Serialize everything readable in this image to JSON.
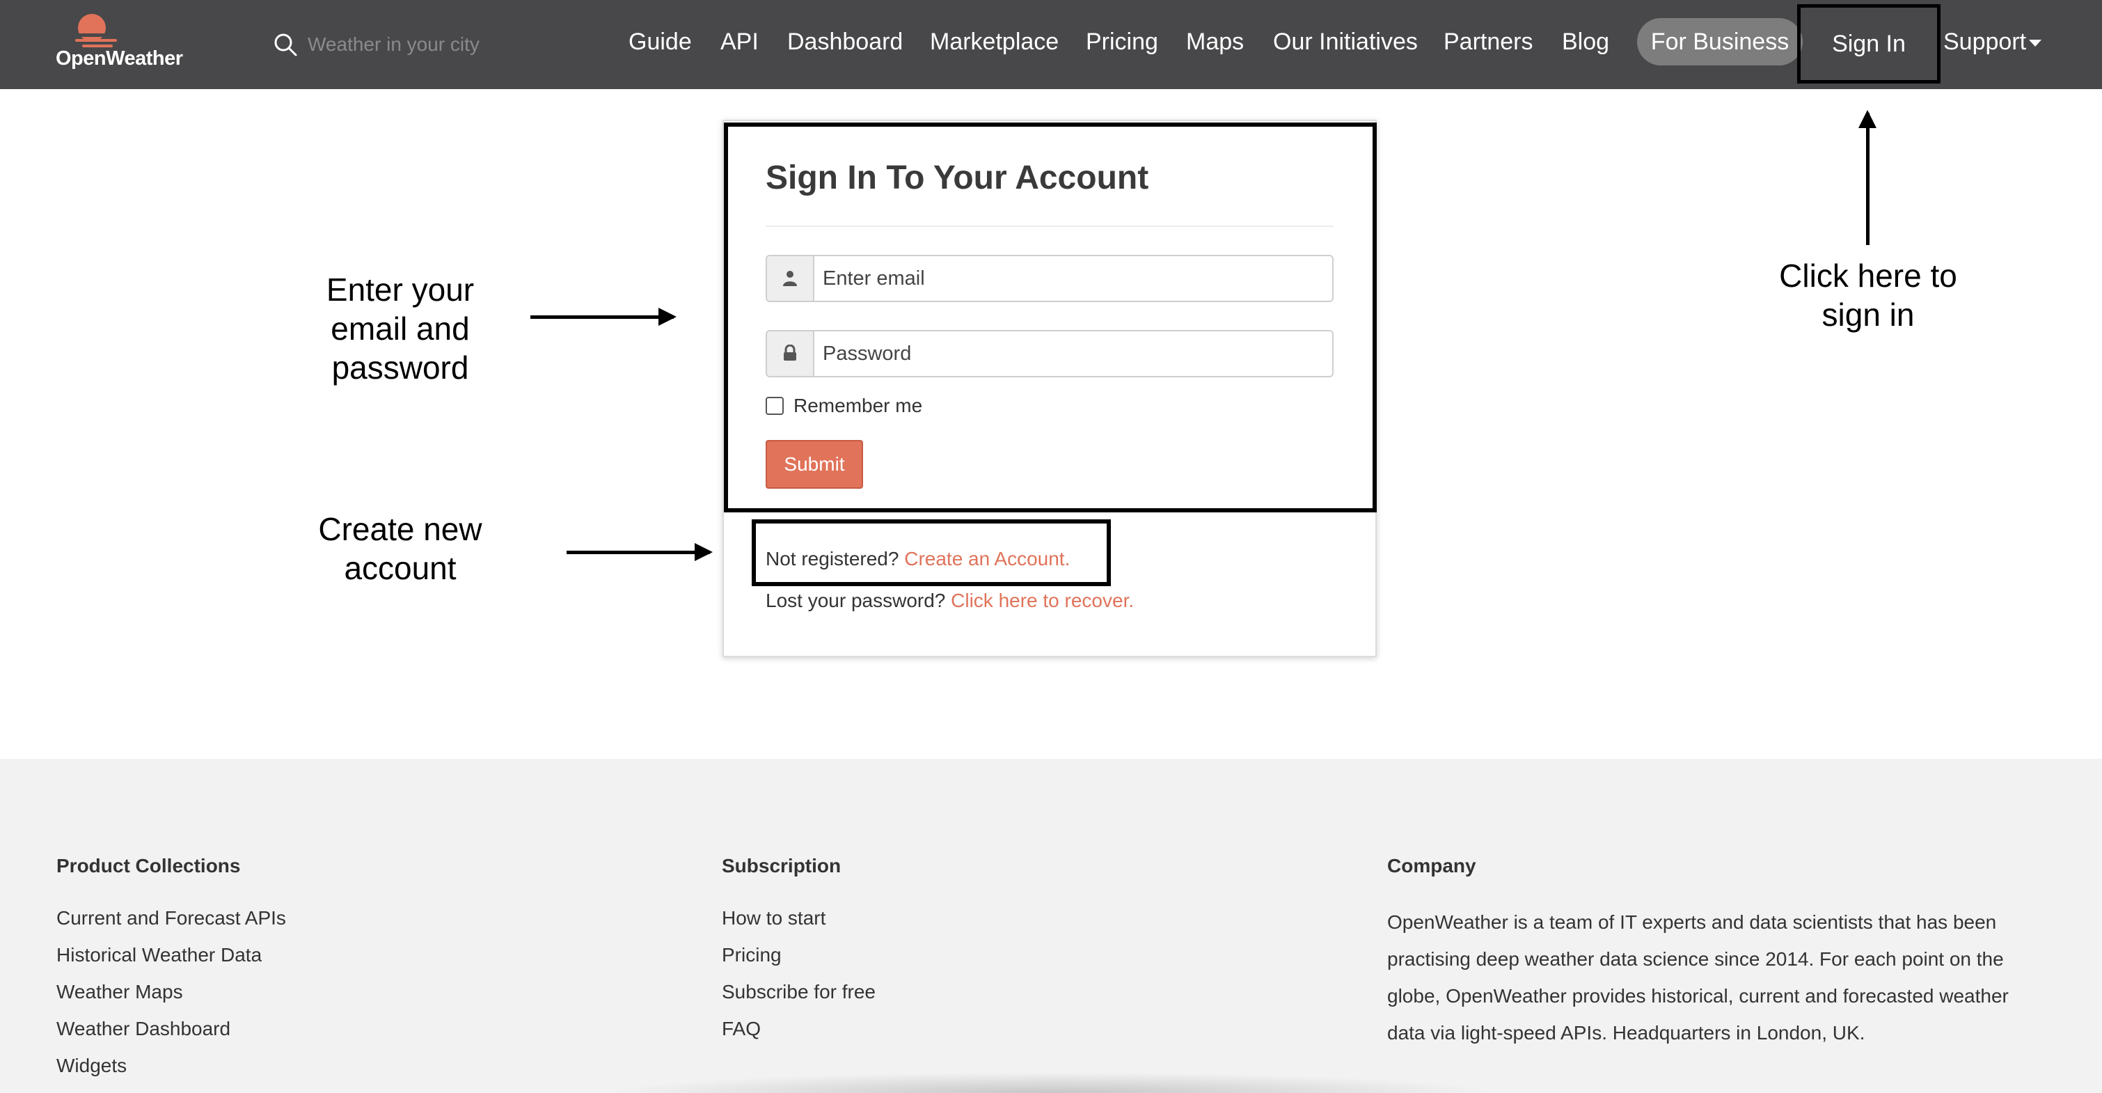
{
  "brand": {
    "name": "OpenWeather",
    "accent": "#e0735a"
  },
  "search": {
    "placeholder": "Weather in your city"
  },
  "nav": {
    "items": [
      {
        "label": "Guide"
      },
      {
        "label": "API"
      },
      {
        "label": "Dashboard"
      },
      {
        "label": "Marketplace"
      },
      {
        "label": "Pricing"
      },
      {
        "label": "Maps"
      },
      {
        "label": "Our Initiatives"
      },
      {
        "label": "Partners"
      },
      {
        "label": "Blog"
      }
    ],
    "business": "For Business",
    "signin": "Sign In",
    "support": "Support"
  },
  "form": {
    "title": "Sign In To Your Account",
    "email_placeholder": "Enter email",
    "password_placeholder": "Password",
    "remember": "Remember me",
    "submit": "Submit",
    "register_prefix": "Not registered?",
    "register_link": "Create an Account.",
    "lost_prefix": "Lost your password?",
    "lost_link": "Click here to recover."
  },
  "annotations": {
    "email_line1": "Enter your",
    "email_line2": "email and",
    "email_line3": "password",
    "create_line1": "Create new",
    "create_line2": "account",
    "signin_line1": "Click here to",
    "signin_line2": "sign in"
  },
  "footer": {
    "products": {
      "heading": "Product Collections",
      "links": [
        "Current and Forecast APIs",
        "Historical Weather Data",
        "Weather Maps",
        "Weather Dashboard",
        "Widgets"
      ]
    },
    "subscription": {
      "heading": "Subscription",
      "links": [
        "How to start",
        "Pricing",
        "Subscribe for free",
        "FAQ"
      ]
    },
    "company": {
      "heading": "Company",
      "text": "OpenWeather is a team of IT experts and data scientists that has been practising deep weather data science since 2014. For each point on the globe, OpenWeather provides historical, current and forecasted weather data via light-speed APIs. Headquarters in London, UK."
    }
  }
}
